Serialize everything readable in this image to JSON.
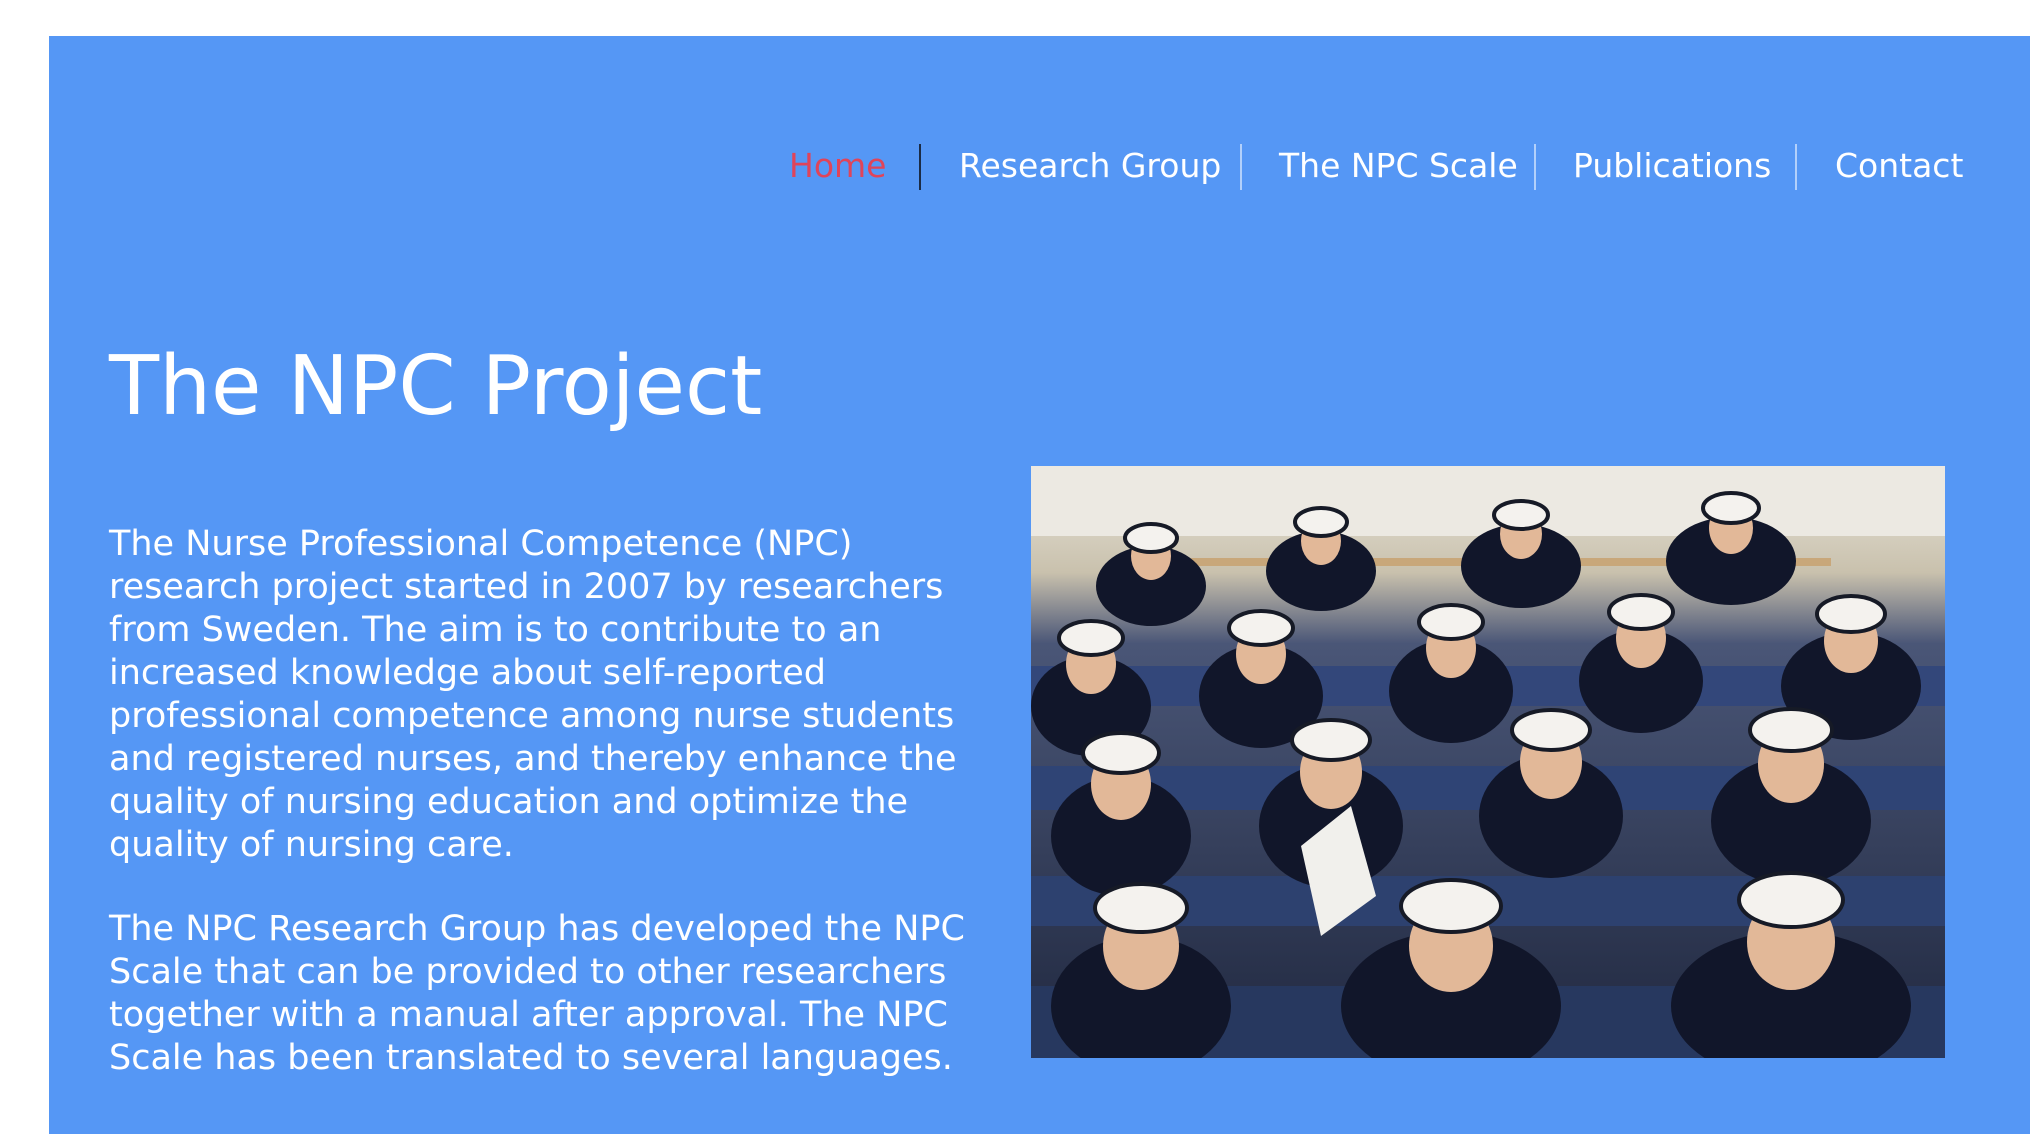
{
  "nav": {
    "items": [
      {
        "label": "Home",
        "active": true
      },
      {
        "label": "Research Group",
        "active": false
      },
      {
        "label": "The NPC Scale",
        "active": false
      },
      {
        "label": "Publications",
        "active": false
      },
      {
        "label": "Contact",
        "active": false
      }
    ]
  },
  "main": {
    "title": "The NPC Project",
    "paragraphs": [
      "The Nurse Professional Competence (NPC) research project started in 2007 by researchers from Sweden. The aim is to contribute to an increased knowledge about self-reported professional competence among nurse students and registered nurses, and thereby enhance the quality of nursing education and optimize the quality of nursing care.",
      "The NPC Research Group has developed the NPC Scale that can be provided to other researchers together with a manual after approval. The NPC Scale has been translated to several languages."
    ]
  },
  "colors": {
    "background": "#5597f5",
    "nav_active": "#e0445a",
    "text": "#ffffff"
  }
}
